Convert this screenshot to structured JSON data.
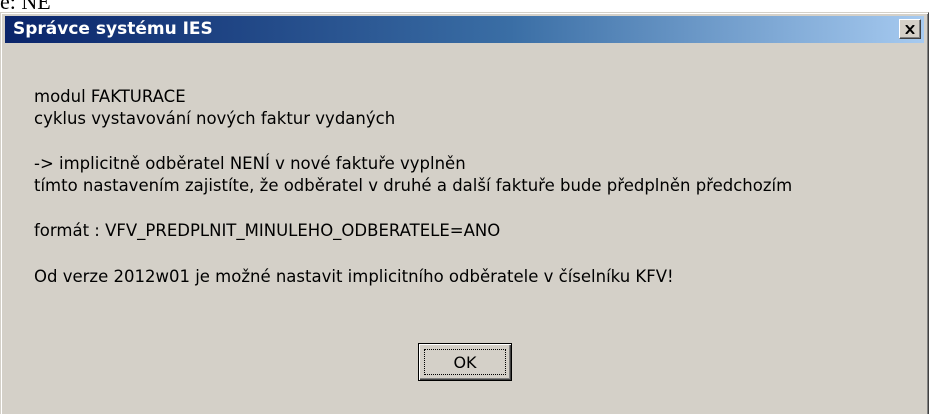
{
  "background_text": "e: NE",
  "dialog": {
    "title": "Správce systému IES",
    "close_symbol": "×",
    "lines": [
      "modul FAKTURACE",
      "cyklus vystavování nových faktur vydaných",
      "-> implicitně odběratel NENÍ v nové faktuře vyplněn",
      "tímto nastavením zajistíte, že odběratel v druhé a další faktuře bude předplněn předchozím",
      "formát : VFV_PREDPLNIT_MINULEHO_ODBERATELE=ANO",
      "Od verze 2012w01 je možné nastavit implicitního odběratele v číselníku KFV!"
    ],
    "ok_label": "OK"
  },
  "colors": {
    "titlebar_start": "#0a246a",
    "titlebar_end": "#a6caf0",
    "face": "#d4d0c8"
  },
  "icons": {
    "close": "close-icon"
  }
}
